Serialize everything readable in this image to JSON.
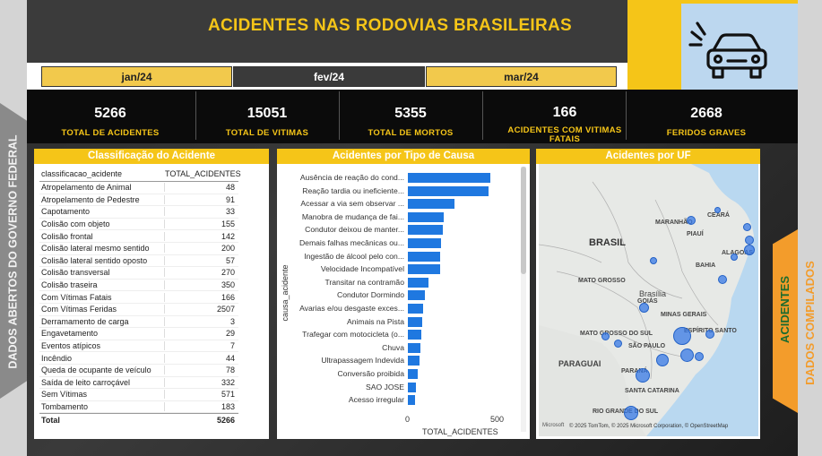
{
  "header": {
    "title": "ACIDENTES NAS RODOVIAS BRASILEIRAS"
  },
  "side": {
    "left_label": "DADOS ABERTOS DO GOVERNO FEDERAL",
    "right_label_1": "ACIDENTES",
    "right_label_2": "DADOS COMPILADOS"
  },
  "months": [
    {
      "label": "jan/24",
      "selected": false
    },
    {
      "label": "fev/24",
      "selected": true
    },
    {
      "label": "mar/24",
      "selected": false
    }
  ],
  "kpis": [
    {
      "value": "5266",
      "label": "TOTAL DE ACIDENTES"
    },
    {
      "value": "15051",
      "label": "TOTAL DE VITIMAS"
    },
    {
      "value": "5355",
      "label": "TOTAL DE MORTOS"
    },
    {
      "value": "166",
      "label": "ACIDENTES COM VITIMAS FATAIS"
    },
    {
      "value": "2668",
      "label": "FERIDOS GRAVES"
    }
  ],
  "classificacao": {
    "title": "Classificação do Acidente",
    "col1": "classificacao_acidente",
    "col2": "TOTAL_ACIDENTES",
    "rows": [
      {
        "name": "Atropelamento de Animal",
        "value": "48"
      },
      {
        "name": "Atropelamento de Pedestre",
        "value": "91"
      },
      {
        "name": "Capotamento",
        "value": "33"
      },
      {
        "name": "Colisão com objeto",
        "value": "155"
      },
      {
        "name": "Colisão frontal",
        "value": "142"
      },
      {
        "name": "Colisão lateral mesmo sentido",
        "value": "200"
      },
      {
        "name": "Colisão lateral sentido oposto",
        "value": "57"
      },
      {
        "name": "Colisão transversal",
        "value": "270"
      },
      {
        "name": "Colisão traseira",
        "value": "350"
      },
      {
        "name": "Com Vítimas Fatais",
        "value": "166"
      },
      {
        "name": "Com Vítimas Feridas",
        "value": "2507"
      },
      {
        "name": "Derramamento de carga",
        "value": "3"
      },
      {
        "name": "Engavetamento",
        "value": "29"
      },
      {
        "name": "Eventos atípicos",
        "value": "7"
      },
      {
        "name": "Incêndio",
        "value": "44"
      },
      {
        "name": "Queda de ocupante de veículo",
        "value": "78"
      },
      {
        "name": "Saída de leito carroçável",
        "value": "332"
      },
      {
        "name": "Sem Vítimas",
        "value": "571"
      },
      {
        "name": "Tombamento",
        "value": "183"
      }
    ],
    "total_label": "Total",
    "total_value": "5266"
  },
  "causa": {
    "title": "Acidentes por Tipo de Causa",
    "ylabel": "causa_acidente",
    "xlabel": "TOTAL_ACIDENTES",
    "ticks": [
      "0",
      "500"
    ]
  },
  "chart_data": {
    "type": "bar",
    "orientation": "horizontal",
    "categories": [
      "Ausência de reação do cond...",
      "Reação tardia ou ineficiente...",
      "Acessar a via sem observar ...",
      "Manobra de mudança de fai...",
      "Condutor deixou de manter...",
      "Demais falhas mecânicas ou...",
      "Ingestão de álcool pelo con...",
      "Velocidade Incompatível",
      "Transitar na contramão",
      "Condutor Dormindo",
      "Avarias e/ou desgaste exces...",
      "Animais na Pista",
      "Trafegar com motocicleta (o...",
      "Chuva",
      "Ultrapassagem Indevida",
      "Conversão proibida",
      "SAO JOSE",
      "Acesso irregular"
    ],
    "values": [
      480,
      470,
      270,
      210,
      205,
      195,
      190,
      185,
      120,
      100,
      90,
      85,
      80,
      75,
      70,
      55,
      45,
      40
    ],
    "xlim": [
      0,
      600
    ],
    "xlabel": "TOTAL_ACIDENTES",
    "ylabel": "causa_acidente"
  },
  "map": {
    "title": "Acidentes por UF",
    "labels": {
      "brasil": "BRASIL",
      "brasilia": "Brasília",
      "paraguai": "PARAGUAI",
      "mato_grosso": "MATO GROSSO",
      "goias": "GOIÁS",
      "minas": "MINAS GERAIS",
      "sao_paulo": "SÃO PAULO",
      "parana": "PARANÁ",
      "santa_catarina": "SANTA CATARINA",
      "rio_grande": "RIO GRANDE DO SUL",
      "bahia": "BAHIA",
      "maranhao": "MARANHÃO",
      "ceara": "CEARÁ",
      "piaui": "PIAUÍ",
      "alagoas": "ALAGOAS",
      "espirito_santo": "ESPÍRITO SANTO",
      "mato_grosso_sul": "MATO GROSSO DO SUL"
    },
    "attribution": "© 2025 TomTom, © 2025 Microsoft Corporation, © OpenStreetMap",
    "brand": "Microsoft"
  }
}
